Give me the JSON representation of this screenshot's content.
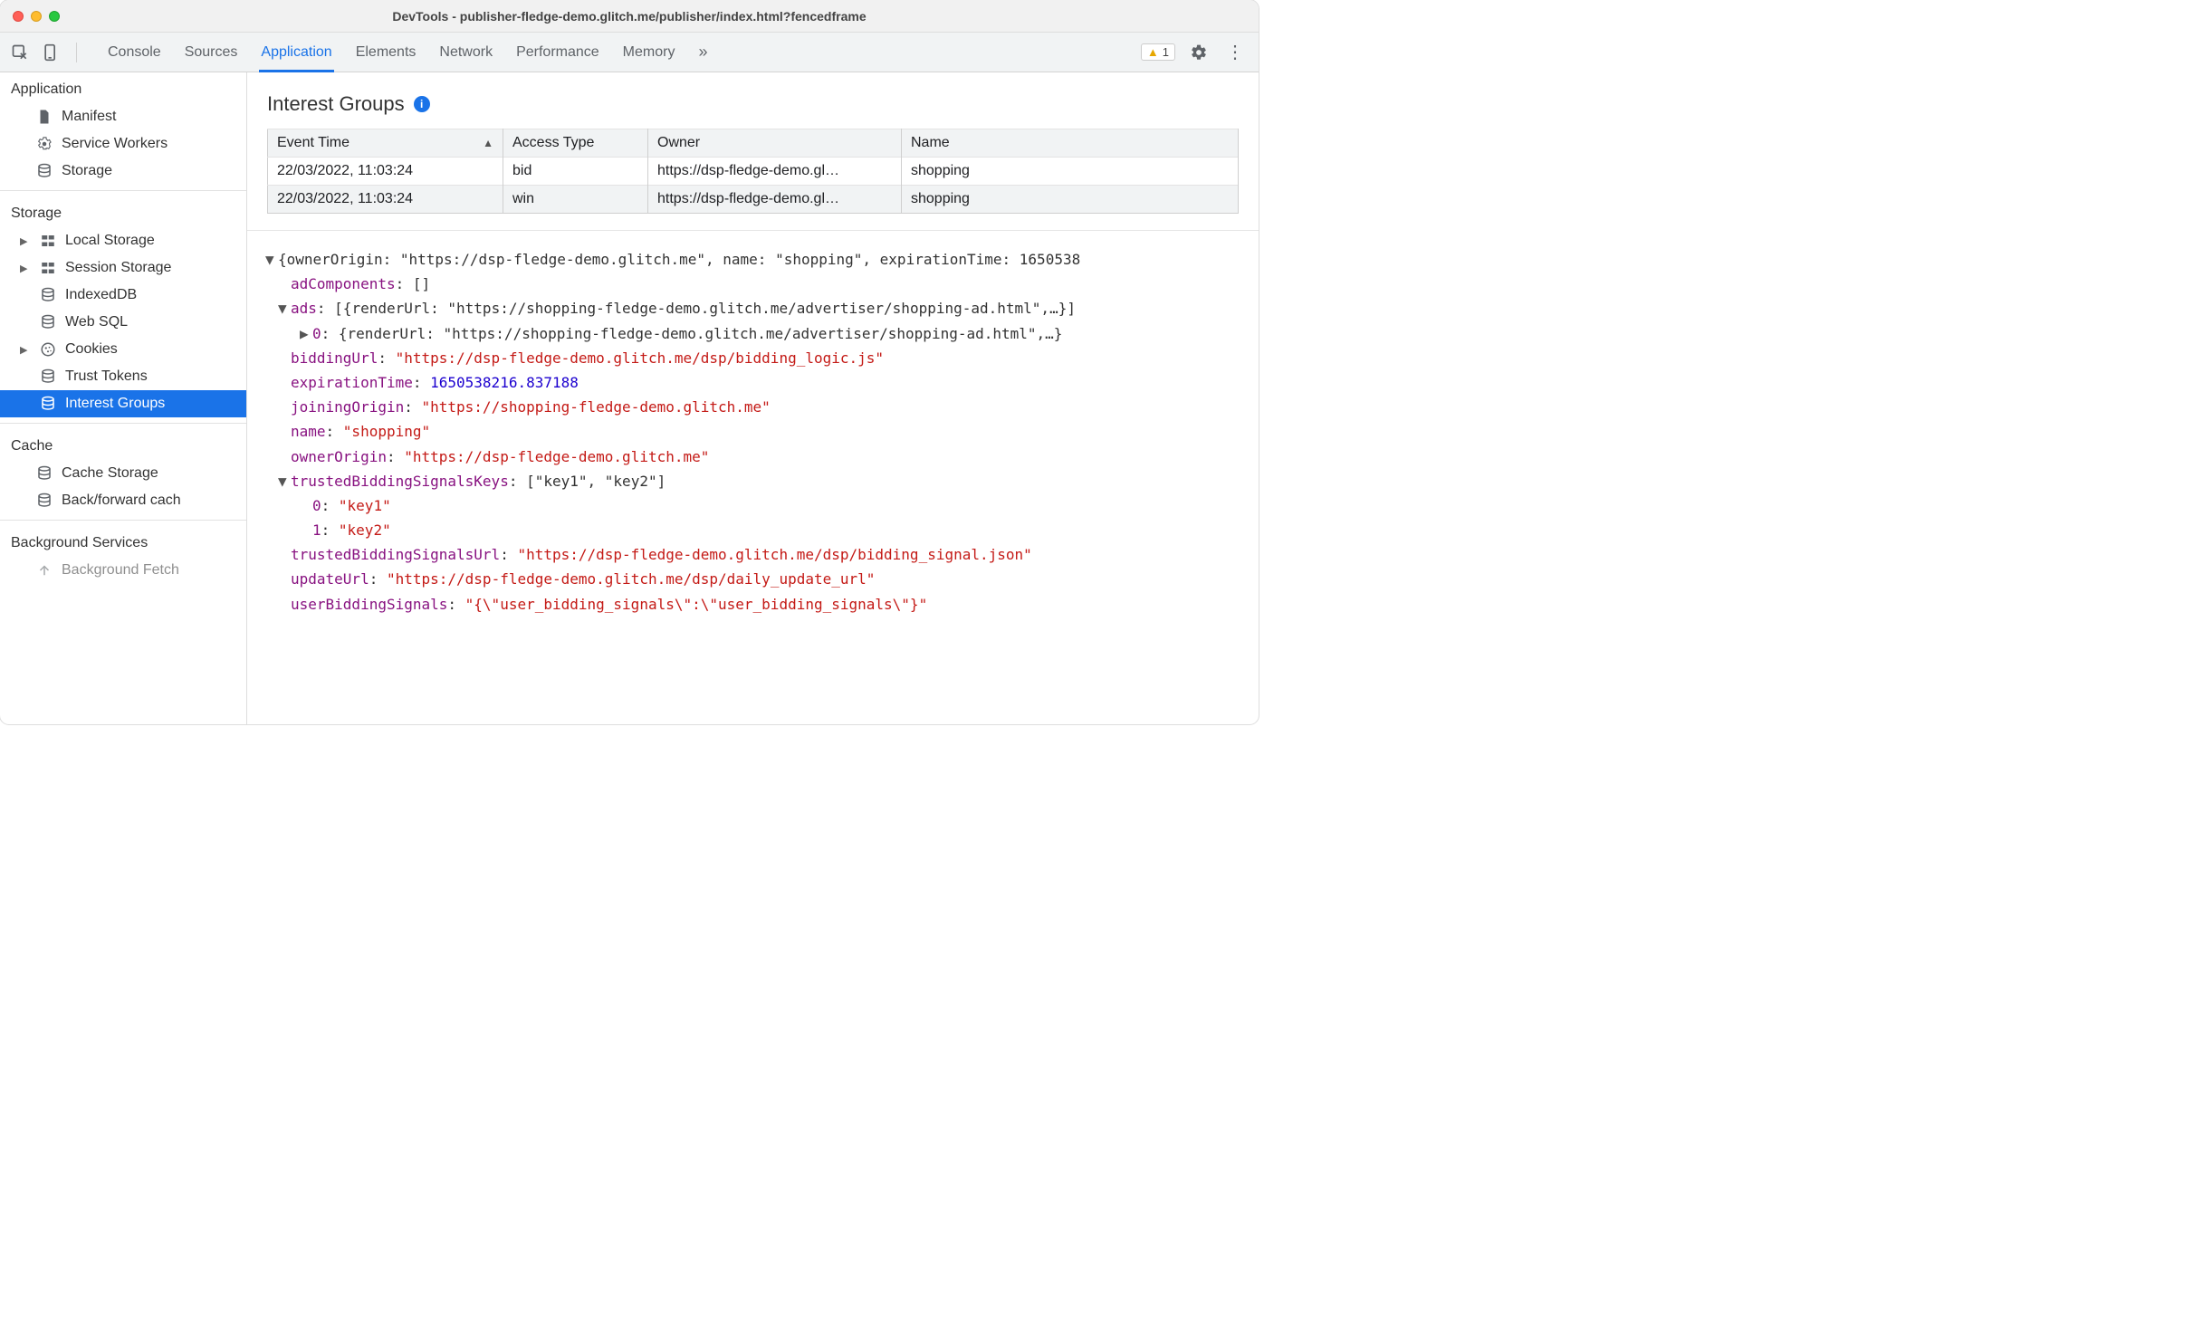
{
  "window": {
    "title": "DevTools - publisher-fledge-demo.glitch.me/publisher/index.html?fencedframe"
  },
  "toolbar": {
    "tabs": [
      "Console",
      "Sources",
      "Application",
      "Elements",
      "Network",
      "Performance",
      "Memory"
    ],
    "active_tab_index": 2,
    "more_tabs_glyph": "»",
    "warning_count": "1"
  },
  "sidebar": {
    "sections": {
      "application": {
        "title": "Application",
        "items": [
          "Manifest",
          "Service Workers",
          "Storage"
        ]
      },
      "storage": {
        "title": "Storage",
        "items": [
          "Local Storage",
          "Session Storage",
          "IndexedDB",
          "Web SQL",
          "Cookies",
          "Trust Tokens",
          "Interest Groups"
        ],
        "selected_index": 6,
        "expandable": [
          true,
          true,
          false,
          false,
          true,
          false,
          false
        ]
      },
      "cache": {
        "title": "Cache",
        "items": [
          "Cache Storage",
          "Back/forward cach"
        ]
      },
      "background": {
        "title": "Background Services",
        "items": [
          "Background Fetch"
        ]
      }
    }
  },
  "main": {
    "heading": "Interest Groups",
    "table": {
      "columns": [
        "Event Time",
        "Access Type",
        "Owner",
        "Name"
      ],
      "sort_column": 0,
      "rows": [
        {
          "time": "22/03/2022, 11:03:24",
          "access": "bid",
          "owner": "https://dsp-fledge-demo.gl…",
          "name": "shopping"
        },
        {
          "time": "22/03/2022, 11:03:24",
          "access": "win",
          "owner": "https://dsp-fledge-demo.gl…",
          "name": "shopping"
        }
      ]
    },
    "detail": {
      "header": "{ownerOrigin: \"https://dsp-fledge-demo.glitch.me\", name: \"shopping\", expirationTime: 1650538",
      "adComponents": "[]",
      "ads_summary": "[{renderUrl: \"https://shopping-fledge-demo.glitch.me/advertiser/shopping-ad.html\",…}]",
      "ads_0": "{renderUrl: \"https://shopping-fledge-demo.glitch.me/advertiser/shopping-ad.html\",…}",
      "biddingUrl": "\"https://dsp-fledge-demo.glitch.me/dsp/bidding_logic.js\"",
      "expirationTime": "1650538216.837188",
      "joiningOrigin": "\"https://shopping-fledge-demo.glitch.me\"",
      "name": "\"shopping\"",
      "ownerOrigin": "\"https://dsp-fledge-demo.glitch.me\"",
      "trustedBiddingSignalsKeys_summary": "[\"key1\", \"key2\"]",
      "trustedBiddingSignalsKeys_0": "\"key1\"",
      "trustedBiddingSignalsKeys_1": "\"key2\"",
      "trustedBiddingSignalsUrl": "\"https://dsp-fledge-demo.glitch.me/dsp/bidding_signal.json\"",
      "updateUrl": "\"https://dsp-fledge-demo.glitch.me/dsp/daily_update_url\"",
      "userBiddingSignals": "\"{\\\"user_bidding_signals\\\":\\\"user_bidding_signals\\\"}\""
    }
  }
}
